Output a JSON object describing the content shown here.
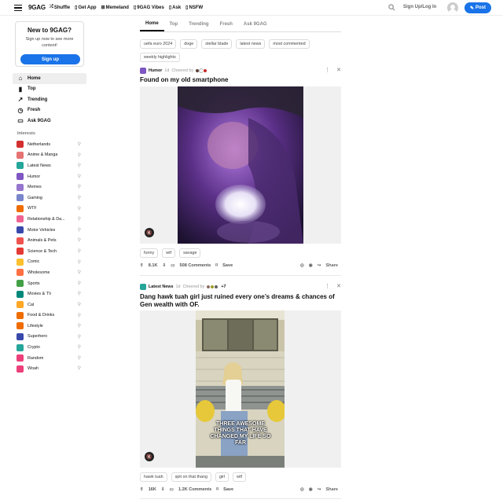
{
  "header": {
    "logo": "9GAG",
    "nav": [
      {
        "icon": "shuffle-icon",
        "label": "Shuffle",
        "glyph": "⤮"
      },
      {
        "icon": "get-app-icon",
        "label": "Get App",
        "glyph": "▯"
      },
      {
        "icon": "memeland-icon",
        "label": "Memeland",
        "glyph": "⊞"
      },
      {
        "icon": "vibes-icon",
        "label": "9GAG Vibes",
        "glyph": "▯"
      },
      {
        "icon": "ask-icon",
        "label": "Ask",
        "glyph": "▯"
      },
      {
        "icon": "nsfw-icon",
        "label": "NSFW",
        "glyph": "▯"
      }
    ],
    "signup_label": "Sign Up/Log In",
    "post_label": "Post",
    "accent": "#1a73e8"
  },
  "promo": {
    "title": "New to 9GAG?",
    "text": "Sign up now to see more content!",
    "button": "Sign up"
  },
  "mainnav": [
    {
      "label": "Home",
      "icon": "home-icon",
      "glyph": "⌂",
      "active": true
    },
    {
      "label": "Top",
      "icon": "top-icon",
      "glyph": "▮"
    },
    {
      "label": "Trending",
      "icon": "trending-icon",
      "glyph": "↗"
    },
    {
      "label": "Fresh",
      "icon": "fresh-icon",
      "glyph": "◷"
    },
    {
      "label": "Ask 9GAG",
      "icon": "ask-9gag-icon",
      "glyph": "▭"
    }
  ],
  "interests_title": "Interests",
  "interests": [
    {
      "label": "Netherlands",
      "color": "#d32f2f"
    },
    {
      "label": "Anime & Manga",
      "color": "#e57373"
    },
    {
      "label": "Latest News",
      "color": "#26a69a"
    },
    {
      "label": "Humor",
      "color": "#7e57c2"
    },
    {
      "label": "Memes",
      "color": "#9575cd"
    },
    {
      "label": "Gaming",
      "color": "#7986cb"
    },
    {
      "label": "WTF",
      "color": "#ef6c00"
    },
    {
      "label": "Relationship & Da...",
      "color": "#f06292"
    },
    {
      "label": "Motor Vehicles",
      "color": "#3949ab"
    },
    {
      "label": "Animals & Pets",
      "color": "#ef5350"
    },
    {
      "label": "Science & Tech",
      "color": "#e53935"
    },
    {
      "label": "Comic",
      "color": "#fbc02d"
    },
    {
      "label": "Wholesome",
      "color": "#ff7043"
    },
    {
      "label": "Sports",
      "color": "#43a047"
    },
    {
      "label": "Movies & TV",
      "color": "#00897b"
    },
    {
      "label": "Cat",
      "color": "#ffa726"
    },
    {
      "label": "Food & Drinks",
      "color": "#ef6c00"
    },
    {
      "label": "Lifestyle",
      "color": "#ef6c00"
    },
    {
      "label": "Superhero",
      "color": "#3949ab"
    },
    {
      "label": "Crypto",
      "color": "#26a69a"
    },
    {
      "label": "Random",
      "color": "#ec407a"
    },
    {
      "label": "Woah",
      "color": "#ec407a"
    }
  ],
  "tabs": [
    "Home",
    "Top",
    "Trending",
    "Fresh",
    "Ask 9GAG"
  ],
  "tags": [
    "uefa euro 2024",
    "doge",
    "stellar blade",
    "latest news",
    "most commented",
    "weekly highlights"
  ],
  "posts": [
    {
      "section": "Humor",
      "section_color": "#7e57c2",
      "age": "1d",
      "cheered": "Cheered by",
      "cheer_extra": "",
      "title": "Found on my old smartphone",
      "tags": [
        "funny",
        "wtf",
        "savage"
      ],
      "upvotes": "8.1K",
      "comments": "508 Comments",
      "save": "Save",
      "share": "Share"
    },
    {
      "section": "Latest News",
      "section_color": "#26a69a",
      "age": "1d",
      "cheered": "Cheered by",
      "cheer_extra": "+7",
      "title": "Dang hawk tuah girl just ruined every one’s dreams & chances of Gen wealth with OF.",
      "overlay_text": "THREE AWESOME THINGS THAT HAVE CHANGED MY LIFE SO FAR",
      "tags": [
        "hawk tuah",
        "spit on that thang",
        "girl",
        "wtf"
      ],
      "upvotes": "16K",
      "comments": "1.2K Comments",
      "save": "Save",
      "share": "Share"
    }
  ]
}
